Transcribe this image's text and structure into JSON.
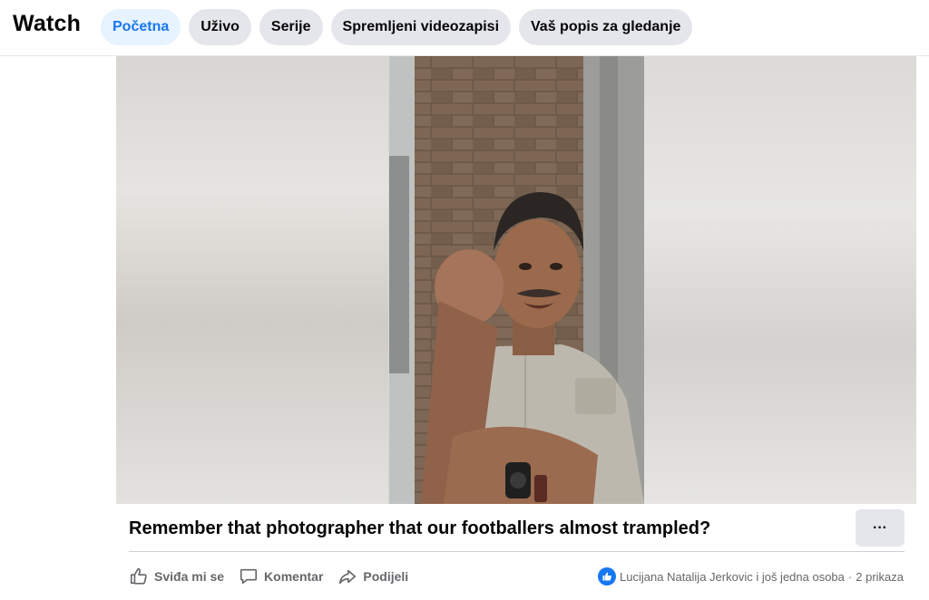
{
  "header": {
    "title": "Watch",
    "tabs": [
      {
        "label": "Početna",
        "active": true
      },
      {
        "label": "Uživo",
        "active": false
      },
      {
        "label": "Serije",
        "active": false
      },
      {
        "label": "Spremljeni videozapisi",
        "active": false
      },
      {
        "label": "Vaš popis za gledanje",
        "active": false
      }
    ]
  },
  "post": {
    "title": "Remember that photographer that our footballers almost trampled?",
    "more_label": "···",
    "actions": {
      "like": "Sviđa mi se",
      "comment": "Komentar",
      "share": "Podijeli"
    },
    "reactions_text": "Lucijana Natalija Jerkovic i još jedna osoba",
    "separator": "·",
    "views": "2 prikaza"
  },
  "colors": {
    "accent": "#1877f2",
    "active_tab_bg": "#e7f3ff",
    "tab_bg": "#e4e6eb",
    "muted_text": "#65676b"
  }
}
